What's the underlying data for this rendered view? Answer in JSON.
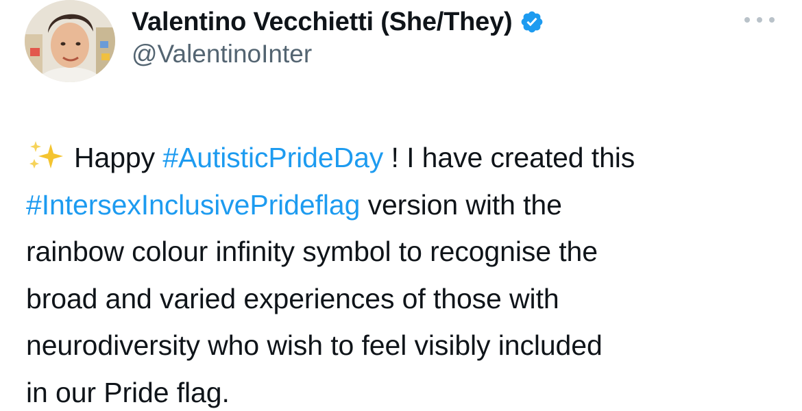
{
  "author": {
    "display_name": "Valentino Vecchietti (She/They)",
    "handle": "@ValentinoInter",
    "verified": true,
    "avatar_icon": "avatar-photo-icon",
    "badge_icon": "verified-badge-icon"
  },
  "menu": {
    "more_icon": "more-options-icon"
  },
  "tweet": {
    "emoji_icon": "sparkles-icon",
    "line1_pre": "Happy ",
    "hashtag1": "#AutisticPrideDay",
    "line1_post": " ! I have created this",
    "hashtag2": "#IntersexInclusivePrideflag",
    "line2_post": " version with the",
    "line3": "rainbow colour infinity symbol to recognise the",
    "line4": "broad and varied experiences of those with",
    "line5": "neurodiversity who wish to feel visibly included",
    "line6": "in our Pride flag."
  },
  "colors": {
    "link": "#1d9bf0",
    "verified": "#1d9bf0",
    "secondary_text": "#536471",
    "primary_text": "#0f1419",
    "sparkle": "#f4c430"
  }
}
